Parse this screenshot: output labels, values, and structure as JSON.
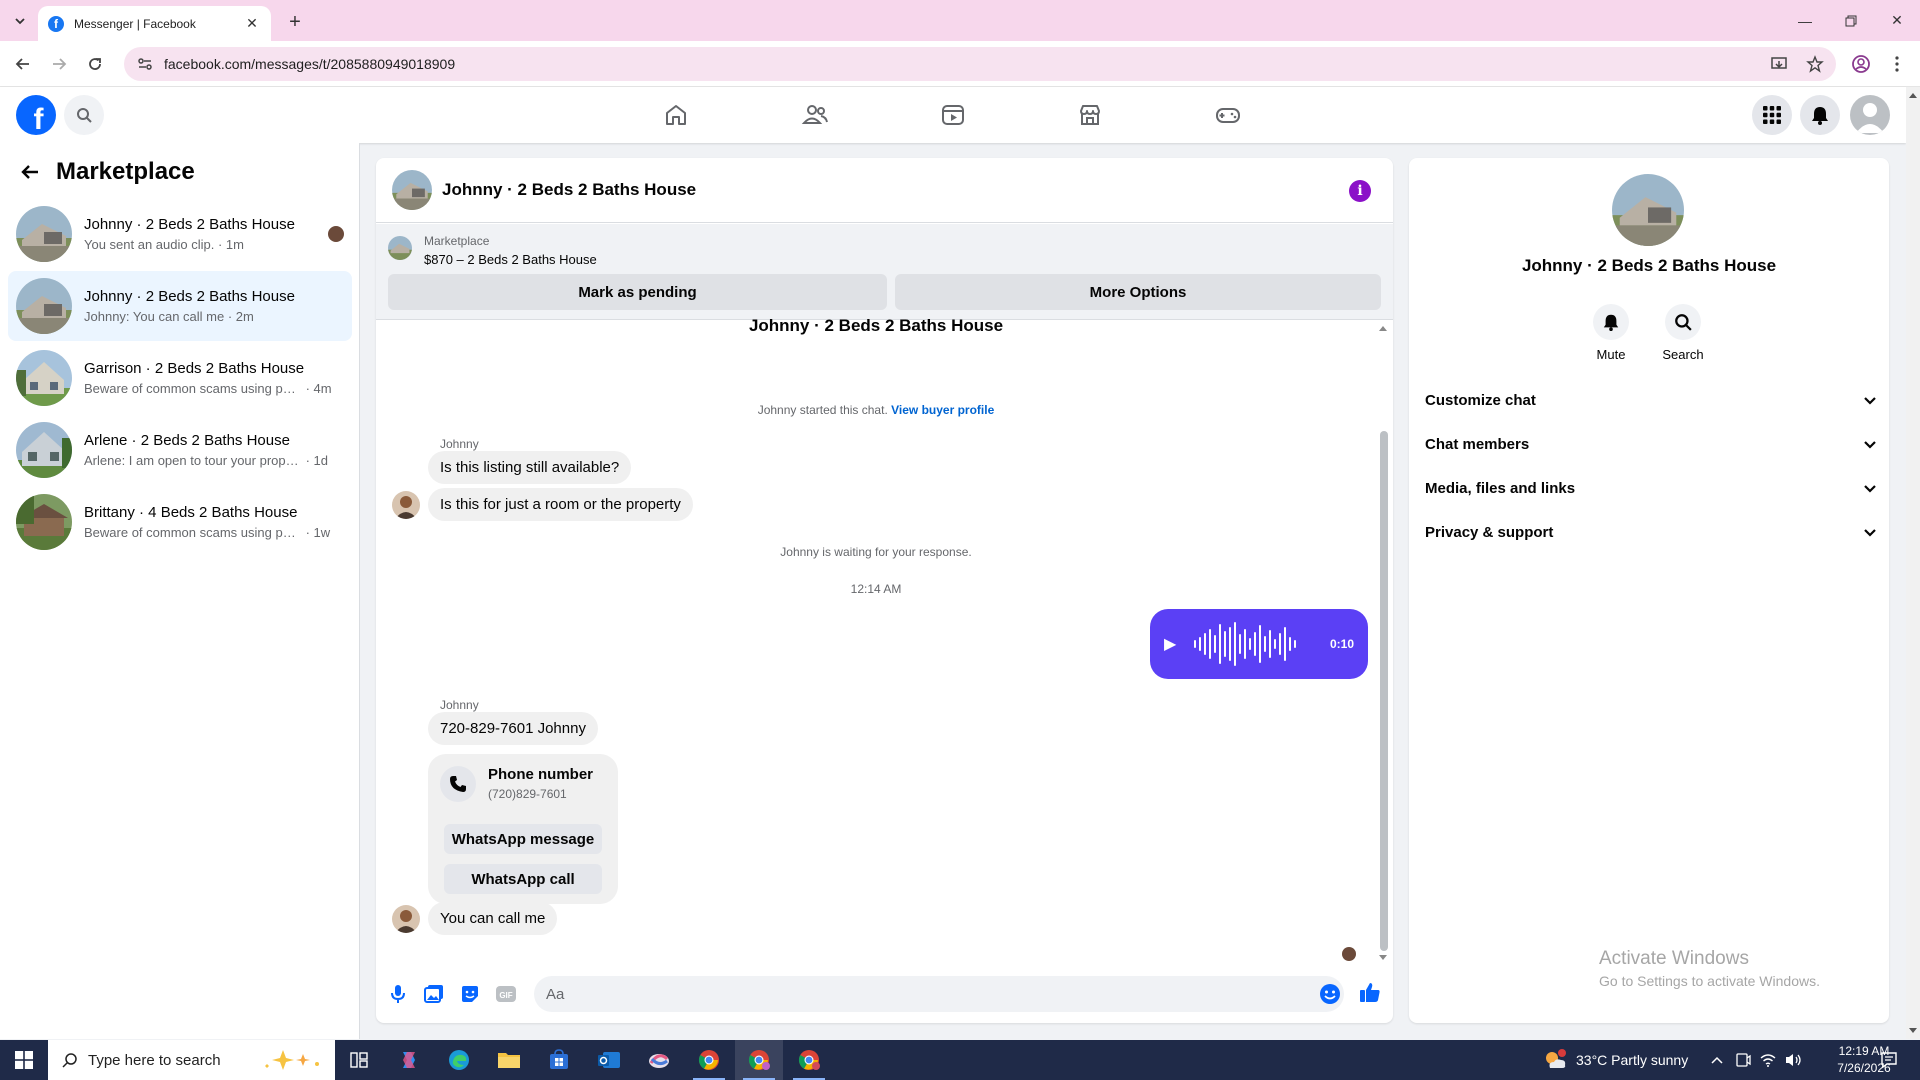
{
  "browser": {
    "tab_title": "Messenger | Facebook",
    "url": "facebook.com/messages/t/2085880949018909"
  },
  "colors": {
    "facebook_blue": "#0866ff",
    "accent_purple": "#5b40f5",
    "info_purple": "#8b10c8",
    "active_row": "#ebf5ff"
  },
  "sidebar": {
    "title": "Marketplace",
    "conversations": [
      {
        "name": "Johnny · 2 Beds 2 Baths House",
        "snippet": "You sent an audio clip.",
        "time": " · 1m",
        "active": false
      },
      {
        "name": "Johnny · 2 Beds 2 Baths House",
        "snippet": "Johnny: You can call me",
        "time": " · 2m",
        "active": true
      },
      {
        "name": "Garrison · 2 Beds 2 Baths House",
        "snippet": "Beware of common scams using pay...",
        "time": " · 4m",
        "active": false
      },
      {
        "name": "Arlene · 2 Beds 2 Baths House",
        "snippet": "Arlene: I am open to tour your proper...",
        "time": " · 1d",
        "active": false
      },
      {
        "name": "Brittany · 4 Beds 2 Baths House",
        "snippet": "Beware of common scams using pay...",
        "time": " · 1w",
        "active": false
      }
    ]
  },
  "chat": {
    "header_name": "Johnny · 2 Beds 2 Baths House",
    "marketplace_label": "Marketplace",
    "listing": "$870 – 2 Beds 2 Baths House",
    "mark_pending": "Mark as pending",
    "more_options": "More Options",
    "conversation_title": "Johnny · 2 Beds 2 Baths House",
    "started_text": "Johnny started this chat.",
    "view_buyer_profile": "View buyer profile",
    "sender_1": "Johnny",
    "msg_1": "Is this listing still available?",
    "msg_2": "Is this for just a room or the property",
    "waiting_text": "Johnny is waiting for your response.",
    "timestamp": "12:14 AM",
    "audio_duration": "0:10",
    "sender_2": "Johnny",
    "msg_3": "720-829-7601 Johnny",
    "phone_card_title": "Phone number",
    "phone_card_number": "(720)829-7601",
    "whatsapp_message": "WhatsApp message",
    "whatsapp_call": "WhatsApp call",
    "msg_4": "You can call me",
    "composer_placeholder": "Aa"
  },
  "right_panel": {
    "name": "Johnny · 2 Beds 2 Baths House",
    "mute_label": "Mute",
    "search_label": "Search",
    "sections": [
      "Customize chat",
      "Chat members",
      "Media, files and links",
      "Privacy & support"
    ]
  },
  "watermark": {
    "line1": "Activate Windows",
    "line2": "Go to Settings to activate Windows."
  },
  "taskbar": {
    "search_placeholder": "Type here to search",
    "weather": "33°C  Partly sunny",
    "time": "12:19 AM",
    "date": "7/26/2026"
  }
}
